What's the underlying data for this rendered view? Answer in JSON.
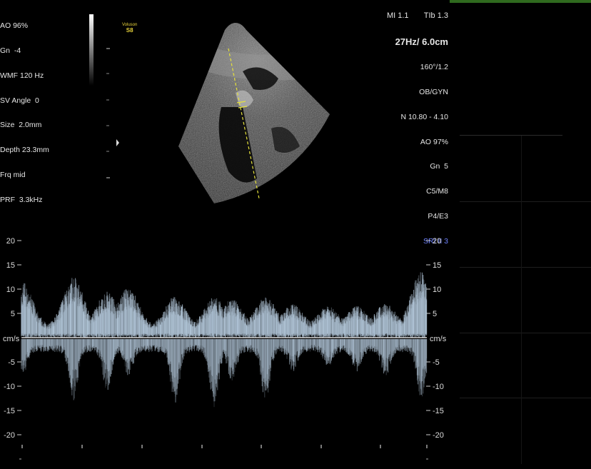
{
  "left_params": [
    "AO 96%",
    "Gn  -4",
    "WMF 120 Hz",
    "SV Angle  0",
    "Size  2.0mm",
    "Depth 23.3mm",
    "Frq mid",
    "PRF  3.3kHz"
  ],
  "right_params": {
    "top_partial": "MI 1.1       TIb 1.3",
    "framerate_depth": "27Hz/ 6.0cm",
    "lines": [
      "160°/1.2",
      "OB/GYN",
      "N 10.80 - 4.10",
      "AO 97%",
      "Gn  5",
      "C5/M8",
      "P4/E3"
    ],
    "sri": "SRI II 3"
  },
  "logo": {
    "brand": "Voluson",
    "model": "S8"
  },
  "doppler": {
    "unit": "cm/s",
    "ticks": [
      20,
      15,
      10,
      5,
      -5,
      -10,
      -15,
      -20
    ]
  },
  "colors": {
    "background": "#000000",
    "spectrum": "#b8cde0",
    "baseline": "#dcdcdc",
    "sample_line": "#e6e23a",
    "sri_blue": "#6f83ff",
    "top_bar_green": "#2f6a1e"
  }
}
